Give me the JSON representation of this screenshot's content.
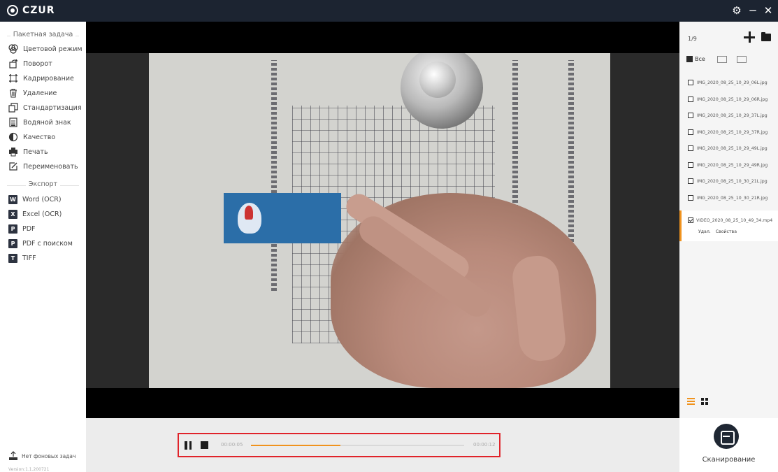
{
  "app": {
    "logo_text": "CZUR",
    "window_controls": {
      "settings_icon": "gear-icon",
      "minimize_icon": "minimize-icon",
      "close_icon": "close-icon"
    }
  },
  "left_panel": {
    "batch_section_label": "Пакетная задача",
    "batch_items": [
      {
        "label": "Цветовой режим",
        "icon": "color-mode-icon"
      },
      {
        "label": "Поворот",
        "icon": "rotate-icon"
      },
      {
        "label": "Кадрирование",
        "icon": "crop-icon"
      },
      {
        "label": "Удаление",
        "icon": "trash-icon"
      },
      {
        "label": "Стандартизация",
        "icon": "standardize-icon"
      },
      {
        "label": "Водяной знак",
        "icon": "watermark-icon"
      },
      {
        "label": "Качество",
        "icon": "quality-icon"
      },
      {
        "label": "Печать",
        "icon": "printer-icon"
      },
      {
        "label": "Переименовать",
        "icon": "rename-icon"
      }
    ],
    "export_section_label": "Экспорт",
    "export_items": [
      {
        "label": "Word (OCR)",
        "badge": "W"
      },
      {
        "label": "Excel (OCR)",
        "badge": "X"
      },
      {
        "label": "PDF",
        "badge": "P"
      },
      {
        "label": "PDF с поиском",
        "badge": "P"
      },
      {
        "label": "TIFF",
        "badge": "T"
      }
    ],
    "background_tasks": "Нет фоновых задач",
    "version": "Version:1.1.200721"
  },
  "player": {
    "time_current": "00:00:05",
    "time_total": "00:00:12",
    "progress_fraction": 0.42,
    "progress_color": "#f0931e"
  },
  "right_panel": {
    "page_counter": "1/9",
    "select_all_label": "Все",
    "files": [
      "IMG_2020_08_25_10_29_06L.jpg",
      "IMG_2020_08_25_10_29_06R.jpg",
      "IMG_2020_08_25_10_29_37L.jpg",
      "IMG_2020_08_25_10_29_37R.jpg",
      "IMG_2020_08_25_10_29_49L.jpg",
      "IMG_2020_08_25_10_29_49R.jpg",
      "IMG_2020_08_25_10_30_21L.jpg",
      "IMG_2020_08_25_10_30_21R.jpg"
    ],
    "video_item": {
      "name": "VIDEO_2020_08_25_10_49_34.mp4",
      "delete_label": "Удал.",
      "properties_label": "Свойства"
    },
    "scan_label": "Сканирование",
    "accent_color": "#f0931e"
  }
}
